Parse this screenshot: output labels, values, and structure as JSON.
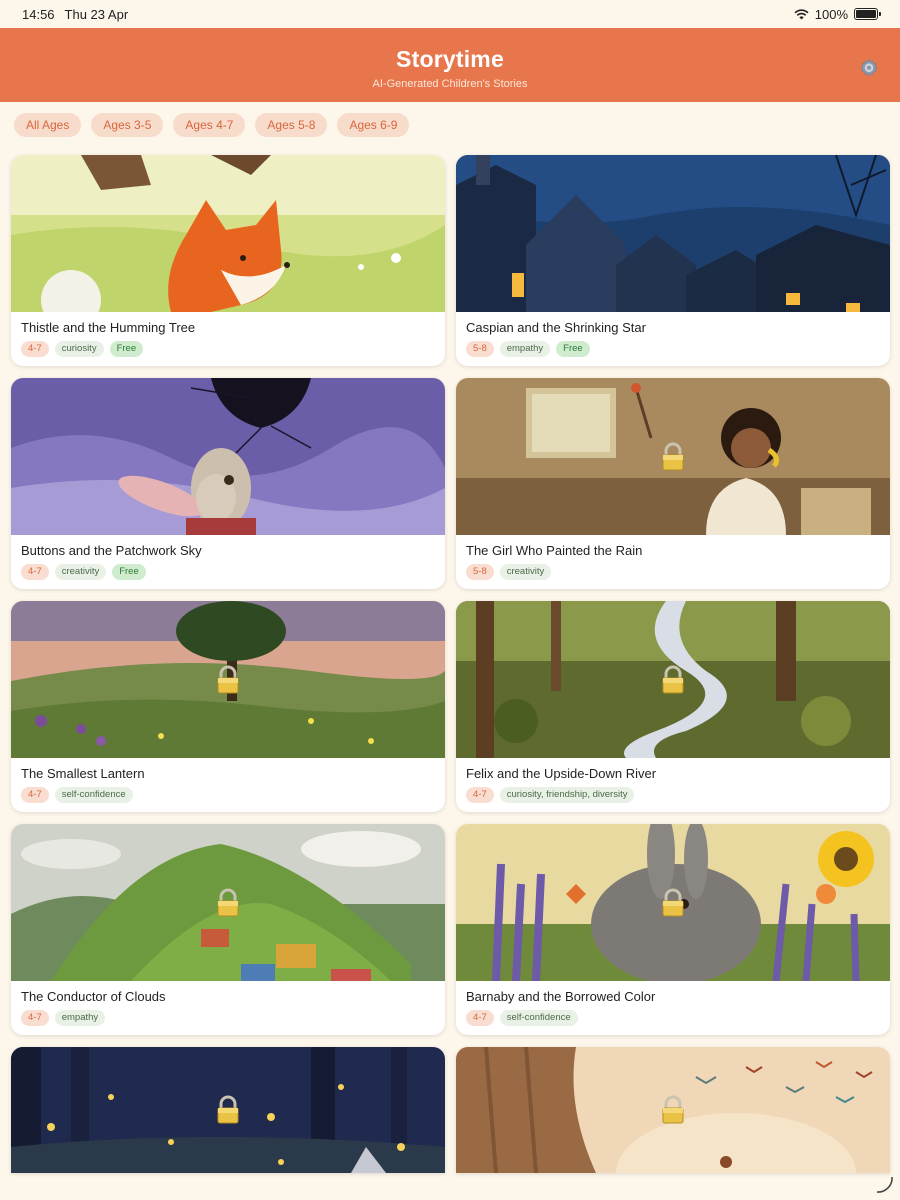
{
  "status": {
    "time": "14:56",
    "date": "Thu 23 Apr",
    "battery": "100%"
  },
  "header": {
    "title": "Storytime",
    "subtitle": "AI-Generated Children's Stories"
  },
  "filters": [
    "All Ages",
    "Ages 3-5",
    "Ages 4-7",
    "Ages 5-8",
    "Ages 6-9"
  ],
  "stories": [
    {
      "title": "Thistle and the Humming Tree",
      "age": "4-7",
      "topic": "curiosity",
      "free": "Free"
    },
    {
      "title": "Caspian and the Shrinking Star",
      "age": "5-8",
      "topic": "empathy",
      "free": "Free"
    },
    {
      "title": "Buttons and the Patchwork Sky",
      "age": "4-7",
      "topic": "creativity",
      "free": "Free"
    },
    {
      "title": "The Girl Who Painted the Rain",
      "age": "5-8",
      "topic": "creativity"
    },
    {
      "title": "The Smallest Lantern",
      "age": "4-7",
      "topic": "self-confidence"
    },
    {
      "title": "Felix and the Upside-Down River",
      "age": "4-7",
      "topic": "curiosity, friendship, diversity"
    },
    {
      "title": "The Conductor of Clouds",
      "age": "4-7",
      "topic": "empathy"
    },
    {
      "title": "Barnaby and the Borrowed Color",
      "age": "4-7",
      "topic": "self-confidence"
    }
  ],
  "colors": {
    "header": "#e8764c",
    "background": "#fdf6ea",
    "chip_bg": "#f8dccb",
    "chip_text": "#d9653e"
  }
}
